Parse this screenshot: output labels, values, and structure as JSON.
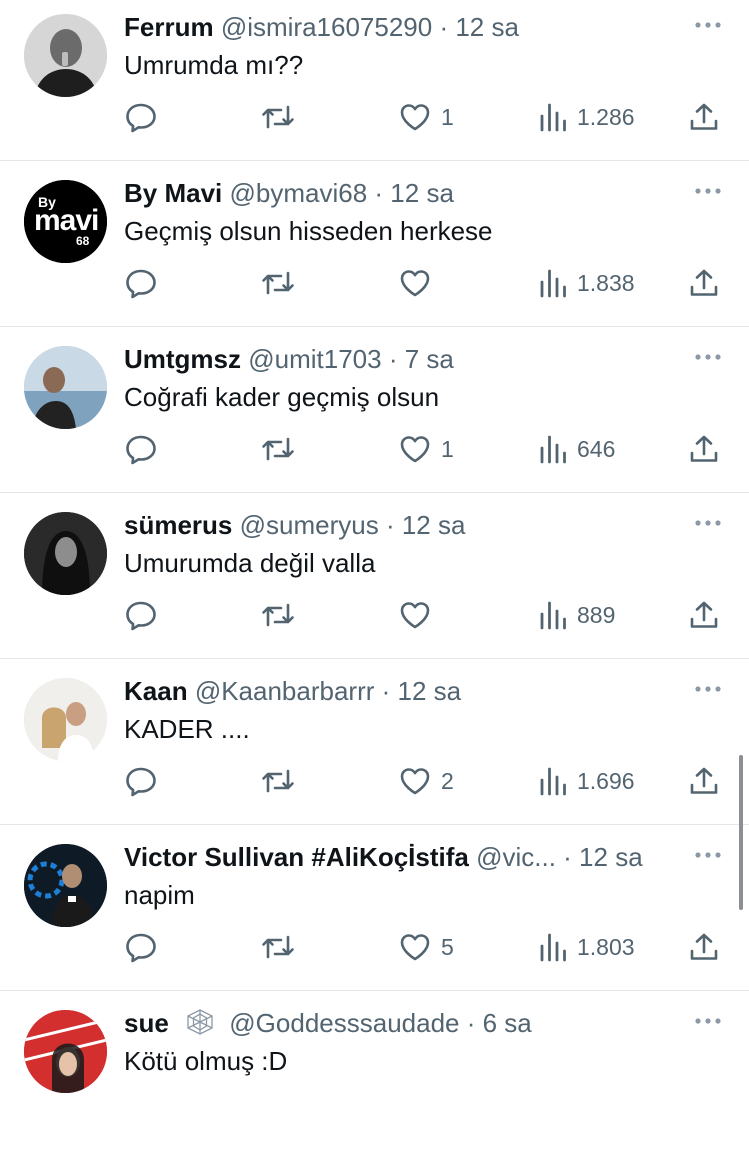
{
  "tweets": [
    {
      "name": "Ferrum",
      "handle": "@ismira16075290",
      "sep": "·",
      "time": "12 sa",
      "text": "Umrumda mı??",
      "reply": "",
      "retweet": "",
      "likes": "1",
      "views": "1.286",
      "avatar_color": "#d9d9d9"
    },
    {
      "name": "By Mavi",
      "handle": "@bymavi68",
      "sep": "·",
      "time": "12 sa",
      "text": "Geçmiş olsun hisseden herkese",
      "reply": "",
      "retweet": "",
      "likes": "",
      "views": "1.838",
      "avatar_color": "#000000",
      "avatar_logo": {
        "top": "By",
        "main": "mavi",
        "num": "68"
      }
    },
    {
      "name": "Umtgmsz",
      "handle": "@umit1703",
      "sep": "·",
      "time": "7 sa",
      "text": "Coğrafi kader geçmiş olsun",
      "reply": "",
      "retweet": "",
      "likes": "1",
      "views": "646",
      "avatar_color": "#9fb7c8"
    },
    {
      "name": "sümerus",
      "handle": "@sumeryus",
      "sep": "·",
      "time": "12 sa",
      "text": "Umurumda değil valla",
      "reply": "",
      "retweet": "",
      "likes": "",
      "views": "889",
      "avatar_color": "#4a4a4a"
    },
    {
      "name": "Kaan",
      "handle": "@Kaanbarbarrr",
      "sep": "·",
      "time": "12 sa",
      "text": "KADER ....",
      "reply": "",
      "retweet": "",
      "likes": "2",
      "views": "1.696",
      "avatar_color": "#e8e6e3"
    },
    {
      "name": "Victor Sullivan #AliKoçİstifa",
      "handle": "@vic...",
      "sep": "·",
      "time": "12 sa",
      "text": "napim",
      "reply": "",
      "retweet": "",
      "likes": "5",
      "views": "1.803",
      "avatar_color": "#1c2a3a"
    },
    {
      "name": "sue",
      "handle": "@Goddesssaudade",
      "sep": "·",
      "time": "6 sa",
      "text": "Kötü olmuş :D",
      "reply": "",
      "retweet": "",
      "likes": "",
      "views": "",
      "avatar_color": "#d93a3a",
      "badge": "spider-web-icon"
    }
  ],
  "colors": {
    "text": "#0f1419",
    "secondary": "#536471",
    "divider": "#e1e6ea"
  }
}
